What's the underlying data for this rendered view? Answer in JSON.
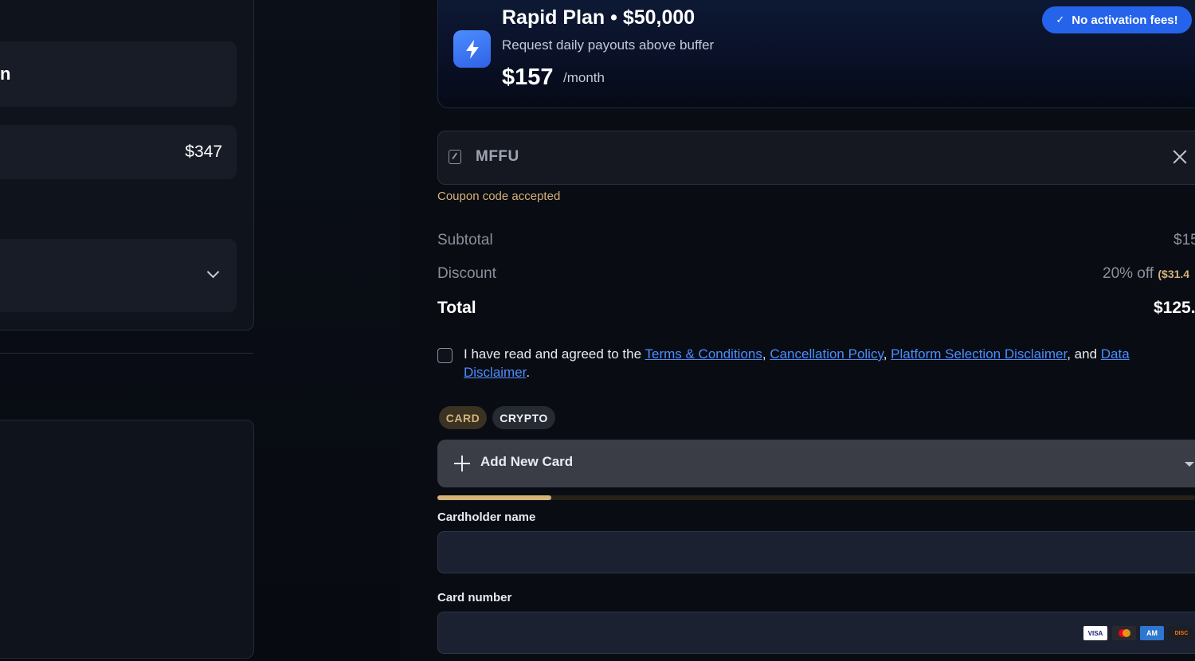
{
  "left": {
    "row1_text": "n",
    "row2_price": "$347"
  },
  "plan": {
    "title": "Rapid Plan • $50,000",
    "subtitle": "Request daily payouts above buffer",
    "price": "$157",
    "period": "/month",
    "badge_label": "No activation fees!",
    "badge_check": "✓",
    "icon": "lightning-bolt-icon"
  },
  "coupon": {
    "code": "MFFU",
    "message": "Coupon code accepted"
  },
  "summary": {
    "subtotal_label": "Subtotal",
    "subtotal_value": "$15",
    "discount_label": "Discount",
    "discount_value": "20% off",
    "discount_amount": "($31.4",
    "total_label": "Total",
    "total_value": "$125."
  },
  "agreement": {
    "prefix": "I have read and agreed to the ",
    "link1": "Terms & Conditions",
    "sep1": ", ",
    "link2": "Cancellation Policy",
    "sep2": ", ",
    "link3": "Platform Selection Disclaimer",
    "sep3": ", and ",
    "link4": "Data Disclaimer",
    "suffix": "."
  },
  "payment": {
    "tab_card": "CARD",
    "tab_crypto": "CRYPTO",
    "add_card_label": "Add New Card",
    "progress_fraction": 0.15
  },
  "form": {
    "cardholder_label": "Cardholder name",
    "cardholder_value": "",
    "card_number_label": "Card number",
    "card_number_value": "",
    "brands": {
      "visa": "VISA",
      "amex": "AM",
      "discover": "DISC"
    }
  },
  "colors": {
    "accent_blue": "#2563eb",
    "accent_gold": "#d5b478",
    "link_blue": "#4c8dff"
  }
}
